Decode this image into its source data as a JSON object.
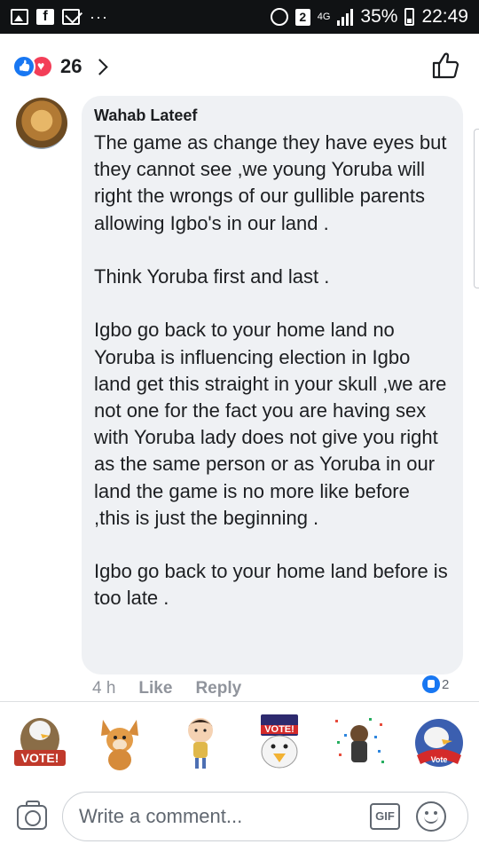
{
  "status_bar": {
    "notification_badge": "2",
    "network": "4G",
    "battery": "35%",
    "time": "22:49",
    "icons": [
      "image-icon",
      "facebook-icon",
      "mail-icon",
      "more-dots-icon",
      "alarm-icon",
      "signal-icon",
      "battery-icon"
    ]
  },
  "reactions": {
    "count": "26",
    "types": [
      "like-icon",
      "love-icon"
    ]
  },
  "comment": {
    "author": "Wahab Lateef",
    "text": "The game as change they have eyes but they cannot see ,we young Yoruba will right the wrongs of our gullible parents allowing Igbo's in our land .\n\nThink Yoruba first and last .\n\nIgbo go back to your home land no Yoruba is influencing election in Igbo land get this straight in your skull ,we are not one for the fact you are having sex with Yoruba lady does not give you right as the same person or as Yoruba in our land the game is no more like before ,this is just the beginning .\n\nIgbo go back to your home land before is too late .",
    "time": "4 h",
    "like_label": "Like",
    "reply_label": "Reply",
    "reaction_count": "2"
  },
  "stickers": [
    {
      "name": "vote-eagle-sticker",
      "label": "VOTE!"
    },
    {
      "name": "dog-sticker",
      "label": ""
    },
    {
      "name": "girl-jumping-sticker",
      "label": ""
    },
    {
      "name": "vote-eagle-hat-sticker",
      "label": "VOTE!"
    },
    {
      "name": "celebration-sticker",
      "label": ""
    },
    {
      "name": "vote-badge-eagle-sticker",
      "label": "Vote"
    }
  ],
  "composer": {
    "placeholder": "Write a comment...",
    "gif_label": "GIF"
  },
  "colors": {
    "accent": "#1877f2",
    "love": "#f33e58",
    "bubble": "#eff1f4"
  }
}
